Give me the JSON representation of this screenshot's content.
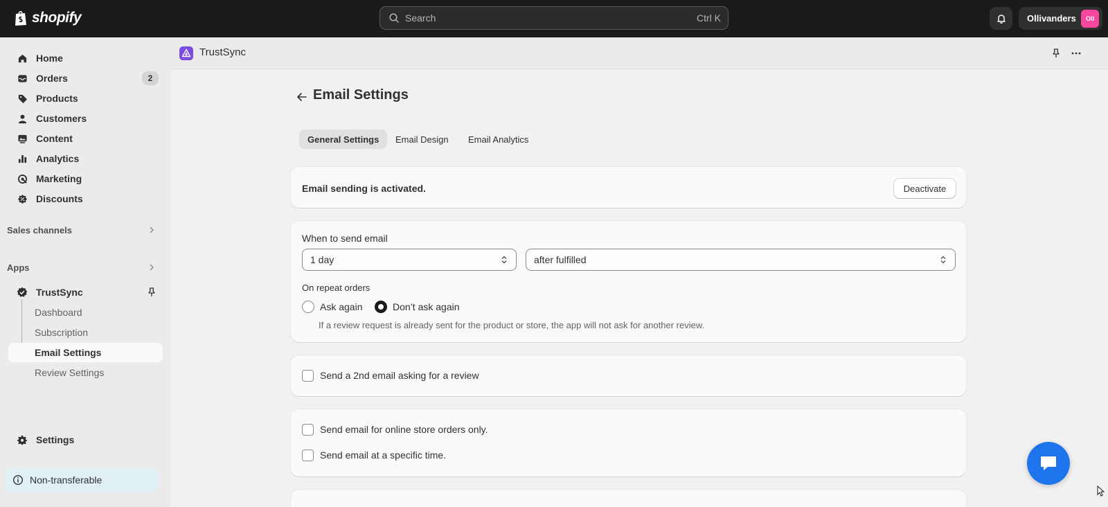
{
  "brand": {
    "name": "shopify"
  },
  "search": {
    "placeholder": "Search",
    "shortcut": "Ctrl K"
  },
  "account": {
    "store_name": "Ollivanders",
    "avatar_initials": "Oll",
    "avatar_color": "#f5479e"
  },
  "sidebar": {
    "items": [
      {
        "label": "Home",
        "icon": "home-icon"
      },
      {
        "label": "Orders",
        "icon": "orders-icon",
        "badge": "2"
      },
      {
        "label": "Products",
        "icon": "tag-icon"
      },
      {
        "label": "Customers",
        "icon": "person-icon"
      },
      {
        "label": "Content",
        "icon": "content-icon"
      },
      {
        "label": "Analytics",
        "icon": "bar-chart-icon"
      },
      {
        "label": "Marketing",
        "icon": "target-icon"
      },
      {
        "label": "Discounts",
        "icon": "discount-icon"
      }
    ],
    "sales_channels": "Sales channels",
    "apps": "Apps",
    "app_name": "TrustSync",
    "app_subitems": [
      "Dashboard",
      "Subscription",
      "Email Settings",
      "Review Settings"
    ],
    "active_subitem": "Email Settings",
    "settings": "Settings",
    "notice": "Non-transferable"
  },
  "app_header": {
    "title": "TrustSync",
    "icon_color": "#7c4dde"
  },
  "page": {
    "title": "Email Settings",
    "tabs": [
      {
        "label": "General Settings",
        "active": true
      },
      {
        "label": "Email Design",
        "active": false
      },
      {
        "label": "Email Analytics",
        "active": false
      }
    ]
  },
  "status_card": {
    "text": "Email sending is activated.",
    "button": "Deactivate"
  },
  "timing_card": {
    "label": "When to send email",
    "delay_value": "1 day",
    "trigger_value": "after fulfilled",
    "repeat_label": "On repeat orders",
    "options": [
      {
        "label": "Ask again",
        "checked": false
      },
      {
        "label": "Don’t ask again",
        "checked": true
      }
    ],
    "help": "If a review request is already sent for the product or store, the app will not ask for another review."
  },
  "second_email_card": {
    "label": "Send a 2nd email asking for a review",
    "checked": false
  },
  "options_card": {
    "online_only": {
      "label": "Send email for online store orders only.",
      "checked": false
    },
    "specific_time": {
      "label": "Send email at a specific time.",
      "checked": false
    }
  }
}
